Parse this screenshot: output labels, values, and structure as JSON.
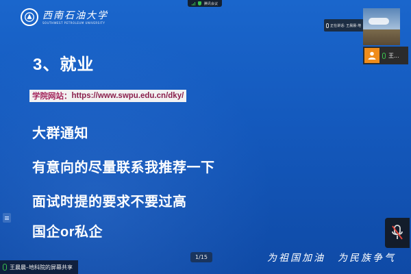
{
  "meeting": {
    "top_label": "腾讯会议",
    "speaking_label": "正在讲话: 王晨晨-地",
    "participant_name": "王...",
    "share_label": "王晨晨–地科院的屏幕共享",
    "page_indicator": "1/15"
  },
  "slide": {
    "logo_text_cn": "西南石油大学",
    "logo_text_en": "SOUTHWEST PETROLEUM UNIVERSITY",
    "title": "3、就业",
    "website_label": "学院网站：",
    "website_url": "https://www.swpu.edu.cn/dky/",
    "bullets": [
      "大群通知",
      "有意向的尽量联系我推荐一下",
      "面试时提的要求不要过高",
      "国企or私企"
    ],
    "motto_left": "为祖国加油",
    "motto_right": "为民族争气"
  },
  "colors": {
    "slide_blue": "#1459bd",
    "website_text": "#a3235a",
    "avatar_orange": "#f08c1a",
    "mic_green": "#3ac24f",
    "mute_red": "#e0463c"
  }
}
